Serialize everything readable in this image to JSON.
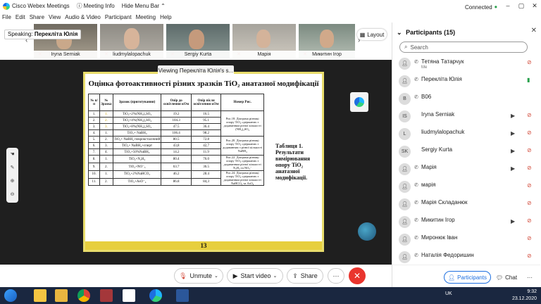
{
  "titlebar": {
    "app_title": "Cisco Webex Meetings",
    "meeting_info": "Meeting Info",
    "hide_menu": "Hide Menu Bar",
    "hide_menu_chev": "⌃",
    "status": "Connected",
    "status_dot": "•"
  },
  "menu": [
    "File",
    "Edit",
    "Share",
    "View",
    "Audio & Video",
    "Participant",
    "Meeting",
    "Help"
  ],
  "speaking": {
    "label": "Speaking:",
    "name": "Перекліта Юлія"
  },
  "layout_label": "Layout",
  "strip_tiles": [
    {
      "name": "Iryna Serniak"
    },
    {
      "name": "liudmylalopachuk"
    },
    {
      "name": "Sergiy Kurta"
    },
    {
      "name": "Марія"
    },
    {
      "name": "Микитин Ігор"
    }
  ],
  "viewing_banner": "Viewing Перекліта Юлія's s...",
  "slide": {
    "title": "Оцінка фотоактивності різних зразків TiO₂ анатазної модифікації",
    "headers": [
      "№ п/п",
      "№ Зразка",
      "Зразок (приготування)",
      "Опір до освітлення кОм",
      "Опір після освітлення кОм",
      "Номер Рис."
    ],
    "rows": [
      {
        "n": "1.",
        "s": "1.",
        "sample": "TiO₂+2%(NH₄)₂SO₄",
        "before": "19.2",
        "after": "16.5"
      },
      {
        "n": "2.",
        "s": "2.",
        "sample": "TiO₂+4%(NH₄)₂SO₄",
        "before": "104.3",
        "after": "95.1"
      },
      {
        "n": "3.",
        "s": "3.",
        "sample": "TiO₂+8%(NH₄)₂SO₄",
        "before": "47.5",
        "after": "36.4"
      },
      {
        "n": "4.",
        "s": "1.",
        "sample": "TiO₂+ NaBH₄",
        "before": "106.4",
        "after": "98.2"
      },
      {
        "n": "5.",
        "s": "2.",
        "sample": "TiO₂+ NaBH₄ покроксталічний",
        "before": "80.5",
        "after": "72.8"
      },
      {
        "n": "6.",
        "s": "3.",
        "sample": "TiO₂+ NaBH₄+спирт",
        "before": "43,8",
        "after": "42,7"
      },
      {
        "n": "7.",
        "s": "4.",
        "sample": "TiO₂+50%NaBH₄",
        "before": "14.2",
        "after": "11.9"
      },
      {
        "n": "8.",
        "s": "1.",
        "sample": "TiO₂+N₂H₄",
        "before": "80.4",
        "after": "76.0"
      },
      {
        "n": "9.",
        "s": "2.",
        "sample": "TiO₂+NO⁻₃",
        "before": "63.7",
        "after": "36.5"
      },
      {
        "n": "10.",
        "s": "1.",
        "sample": "TiO₂+2%NaHCO₃",
        "before": "46.2",
        "after": "28.4"
      },
      {
        "n": "11.",
        "s": "2.",
        "sample": "TiO₂+AsO⁻₄",
        "before": "86.8",
        "after": "84,3"
      }
    ],
    "remarks": [
      "Рис.18. Діаграма різниці опору TiO₂ одержаних з додаванням різної кількості (NH₄)₂SO₄",
      "Рис.20. Діаграма різниці опору TiO₂ одержаних з додаванням з різної кількості NaBH₄",
      "Рис.22. Діаграма різниці опору TiO₂ одержаних з додаванням різної кількості N₂H₄ та NO₃⁻",
      "Рис.24. Діаграма різниці опору TiO₂ одержаних з додаванням різної кількості NaHCO₃ та AsO₄"
    ],
    "caption": "Таблиця 1. Результати вимірювання опору TiO₂ анатазної модифікації.",
    "page_number": "13"
  },
  "controls": {
    "unmute": "Unmute",
    "start_video": "Start video",
    "share": "Share",
    "more": "···",
    "end": "✕"
  },
  "panel": {
    "title": "Participants (15)",
    "search_placeholder": "Search",
    "participants": [
      {
        "initials": "",
        "name": "Тетяна Татарчук",
        "sub": "Me",
        "mic": "muted",
        "cam": false
      },
      {
        "initials": "",
        "name": "Перекліта Юлія",
        "sub": "",
        "mic": "on",
        "cam": false
      },
      {
        "initials": "B",
        "name": "B06",
        "sub": "",
        "mic": "",
        "cam": false
      },
      {
        "initials": "IS",
        "name": "Iryna Serniak",
        "sub": "",
        "mic": "muted",
        "cam": true
      },
      {
        "initials": "L",
        "name": "liudmylalopachuk",
        "sub": "",
        "mic": "muted",
        "cam": true
      },
      {
        "initials": "SK",
        "name": "Sergiy Kurta",
        "sub": "",
        "mic": "muted",
        "cam": true
      },
      {
        "initials": "",
        "name": "Марія",
        "sub": "",
        "mic": "muted",
        "cam": true
      },
      {
        "initials": "",
        "name": "марія",
        "sub": "",
        "mic": "muted",
        "cam": false
      },
      {
        "initials": "",
        "name": "Марія Складанюк",
        "sub": "",
        "mic": "muted",
        "cam": false
      },
      {
        "initials": "",
        "name": "Микитин Ігор",
        "sub": "",
        "mic": "muted",
        "cam": true
      },
      {
        "initials": "",
        "name": "Миронюк Іван",
        "sub": "",
        "mic": "muted",
        "cam": false
      },
      {
        "initials": "",
        "name": "Наталія Федоришин",
        "sub": "",
        "mic": "muted",
        "cam": false
      }
    ],
    "participants_btn": "Participants",
    "chat_btn": "Chat",
    "more_btn": "···"
  },
  "taskbar": {
    "lang": "UK",
    "time": "9:32",
    "date": "23.12.2020"
  },
  "colors": {
    "accent": "#1d6fe0",
    "end_call": "#e9352e",
    "slide_border": "#e8dc6b",
    "taskbar": "#1a2740"
  }
}
